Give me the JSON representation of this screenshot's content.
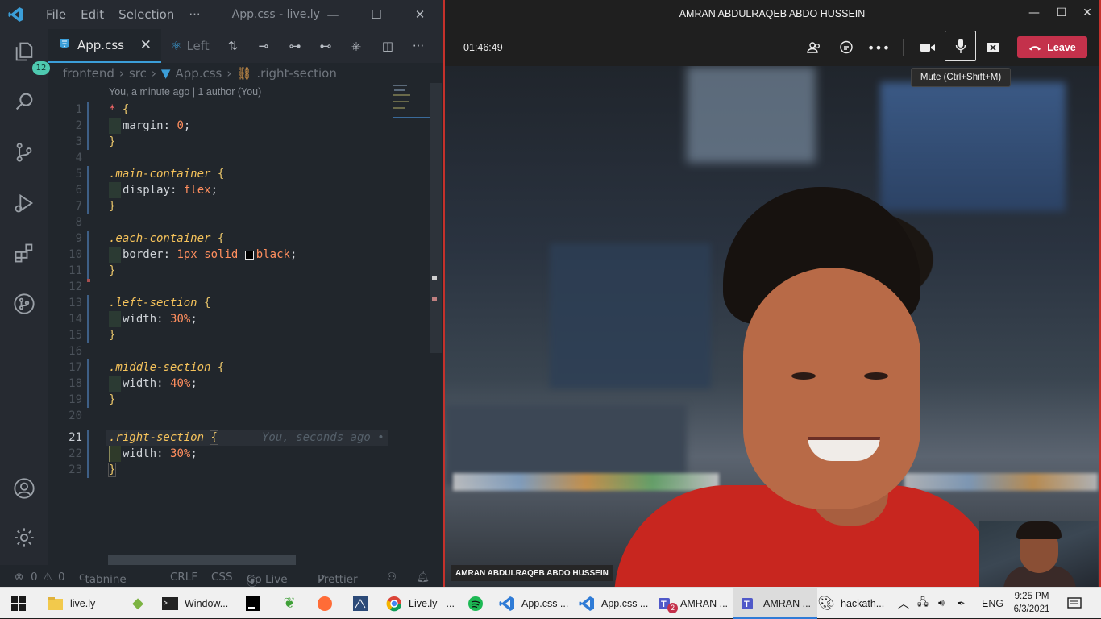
{
  "vscode": {
    "titlebar": {
      "menus": [
        "File",
        "Edit",
        "Selection",
        "···"
      ],
      "title": "App.css - live.ly",
      "minimize": "—",
      "maximize": "☐",
      "close": "✕"
    },
    "activity": {
      "explorer_badge": "12"
    },
    "tab": {
      "name": "App.css",
      "close": "✕",
      "compare_label": "Left"
    },
    "breadcrumb": [
      "frontend",
      "src",
      "App.css",
      ".right-section"
    ],
    "codelens": "You, a minute ago | 1 author (You)",
    "lines": [
      {
        "n": "1"
      },
      {
        "n": "2"
      },
      {
        "n": "3"
      },
      {
        "n": "4"
      },
      {
        "n": "5"
      },
      {
        "n": "6"
      },
      {
        "n": "7"
      },
      {
        "n": "8"
      },
      {
        "n": "9"
      },
      {
        "n": "10"
      },
      {
        "n": "11"
      },
      {
        "n": "12"
      },
      {
        "n": "13"
      },
      {
        "n": "14"
      },
      {
        "n": "15"
      },
      {
        "n": "16"
      },
      {
        "n": "17"
      },
      {
        "n": "18"
      },
      {
        "n": "19"
      },
      {
        "n": "20"
      },
      {
        "n": "21"
      },
      {
        "n": "22"
      },
      {
        "n": "23"
      }
    ],
    "code": {
      "l1_star": "*",
      "open": "{",
      "close": "}",
      "margin_prop": "margin:",
      "margin_val": "0",
      "semi": ";",
      "sel_main": ".main-container",
      "display_prop": "display:",
      "display_val": "flex",
      "sel_each": ".each-container",
      "border_prop": "border:",
      "border_num": "1px",
      "border_style": "solid",
      "border_color": "black",
      "sel_left": ".left-section",
      "width_prop": "width:",
      "left_val": "30%",
      "sel_middle": ".middle-section",
      "middle_val": "40%",
      "sel_right": ".right-section",
      "right_val": "30%",
      "blame": "You, seconds ago •"
    },
    "status": {
      "errors": "0",
      "warnings": "0",
      "tabnine": "tabnine",
      "eol": "CRLF",
      "lang": "CSS",
      "golive": "Go Live",
      "prettier": "Prettier"
    }
  },
  "teams": {
    "title": "AMRAN ABDULRAQEB ABDO HUSSEIN",
    "timer": "01:46:49",
    "leave": "Leave",
    "tooltip": "Mute (Ctrl+Shift+M)",
    "name_tag": "AMRAN ABDULRAQEB ABDO HUSSEIN",
    "window": {
      "minimize": "—",
      "maximize": "☐",
      "close": "✕"
    }
  },
  "taskbar": {
    "items": [
      {
        "label": "live.ly"
      },
      {
        "label": "Window..."
      },
      {
        "label": "Live.ly - ..."
      },
      {
        "label": "App.css ..."
      },
      {
        "label": "App.css ..."
      },
      {
        "label": "AMRAN ..."
      },
      {
        "label": "AMRAN ..."
      },
      {
        "label": "hackath..."
      }
    ],
    "teams_badge": "2",
    "lang": "ENG",
    "time": "9:25 PM",
    "date": "6/3/2021"
  }
}
